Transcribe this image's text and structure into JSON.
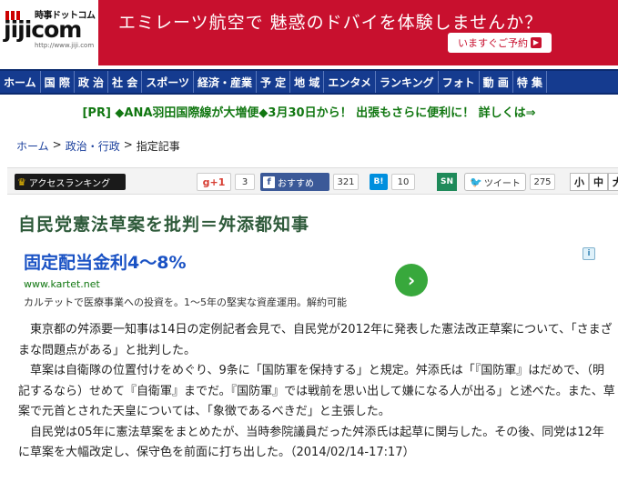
{
  "header": {
    "logo_sub": "時事ドットコム",
    "logo_main": "jijicom",
    "logo_url": "http://www.jiji.com",
    "banner_text": "エミレーツ航空で 魅惑のドバイを体験しませんか？",
    "banner_button": "いますぐご予約"
  },
  "nav": [
    "ホーム",
    "国 際",
    "政 治",
    "社 会",
    "スポーツ",
    "経済・産業",
    "予 定",
    "地 域",
    "エンタメ",
    "ランキング",
    "フォト",
    "動 画",
    "特 集"
  ],
  "pr": "[PR] ◆ANA羽田国際線が大増便◆3月30日から！ 出張もさらに便利に！ 詳しくは⇒",
  "breadcrumb": {
    "home": "ホーム",
    "sep1": ">",
    "category": "政治・行政",
    "sep2": ">",
    "current": "指定記事"
  },
  "toolbar": {
    "ranking": "アクセスランキング",
    "gplus_label": "g+1",
    "gplus_count": "3",
    "fb_label": "おすすめ",
    "fb_count": "321",
    "hatena_label": "B!",
    "hatena_count": "10",
    "sn_label": "SN",
    "tweet_label": "ツイート",
    "tweet_count": "275",
    "size_small": "小",
    "size_medium": "中",
    "size_large": "大"
  },
  "article": {
    "title": "自民党憲法草案を批判＝舛添都知事",
    "paragraphs": [
      "東京都の舛添要一知事は14日の定例記者会見で、自民党が2012年に発表した憲法改正草案について、「さまざまな問題点がある」と批判した。",
      "草案は自衛隊の位置付けをめぐり、9条に「国防軍を保持する」と規定。舛添氏は「『国防軍』はだめで、（明記するなら）せめて『自衛軍』までだ。『国防軍』では戦前を思い出して嫌になる人が出る」と述べた。また、草案で元首とされた天皇については、「象徴であるべきだ」と主張した。",
      "自民党は05年に憲法草案をまとめたが、当時参院議員だった舛添氏は起草に関与した。その後、同党は12年に草案を大幅改定し、保守色を前面に打ち出した。（2014/02/14-17:17）"
    ]
  },
  "ad": {
    "title": "固定配当金利4～8%",
    "url": "www.kartet.net",
    "description": "カルテットで医療事業への投資を。1～5年の堅実な資産運用。解約可能",
    "info_icon": "i"
  },
  "colors": {
    "banner": "#c8102e",
    "nav": "#153b8f",
    "pr_text": "#117711",
    "title": "#2e5a3a",
    "ad_title": "#1a52c4"
  }
}
